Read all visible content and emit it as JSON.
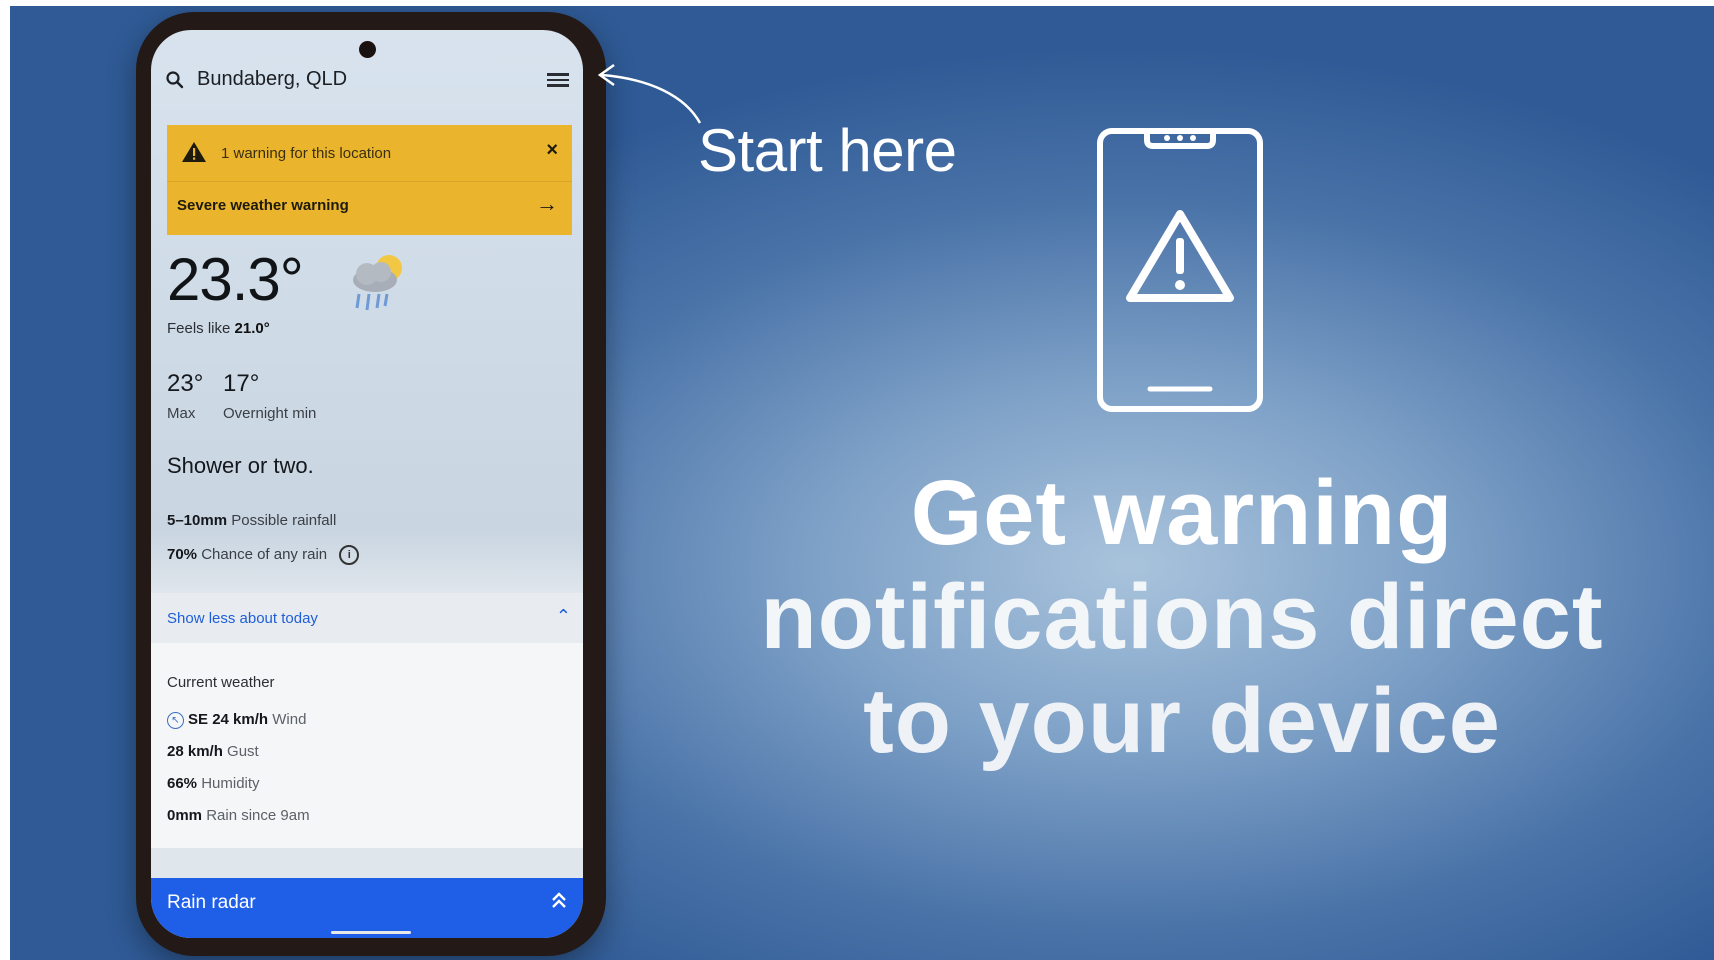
{
  "phone": {
    "location": "Bundaberg, QLD",
    "warning": {
      "count_text": "1 warning for this location",
      "title": "Severe weather warning",
      "close_glyph": "×",
      "arrow_glyph": "→"
    },
    "temperature": "23.3°",
    "feels_label": "Feels like",
    "feels_value": "21.0°",
    "max": "23°",
    "min": "17°",
    "max_label": "Max",
    "min_label": "Overnight min",
    "summary": "Shower or two.",
    "rainfall_value": "5–10mm",
    "rainfall_label": "Possible rainfall",
    "chance_value": "70%",
    "chance_label": "Chance of any rain",
    "show_less": "Show less about today",
    "current_weather": {
      "title": "Current weather",
      "wind_dir": "SE",
      "wind_value": "24 km/h",
      "wind_label": "Wind",
      "gust_value": "28 km/h",
      "gust_label": "Gust",
      "humidity_value": "66%",
      "humidity_label": "Humidity",
      "rain_value": "0mm",
      "rain_label": "Rain since 9am"
    },
    "radar_label": "Rain radar"
  },
  "callout": "Start here",
  "headline": {
    "line1": "Get warning",
    "line2": "notifications direct",
    "line3": "to your device"
  },
  "colors": {
    "warning_bg": "#eab52c",
    "radar_bg": "#1f5ee6",
    "link": "#1f5fd6"
  },
  "icons": [
    "search-icon",
    "menu-icon",
    "warning-triangle-icon",
    "close-icon",
    "arrow-right-icon",
    "rain-cloud-icon",
    "info-icon",
    "chevron-up-icon",
    "wind-direction-icon",
    "double-chevron-up-icon",
    "phone-warning-icon"
  ]
}
